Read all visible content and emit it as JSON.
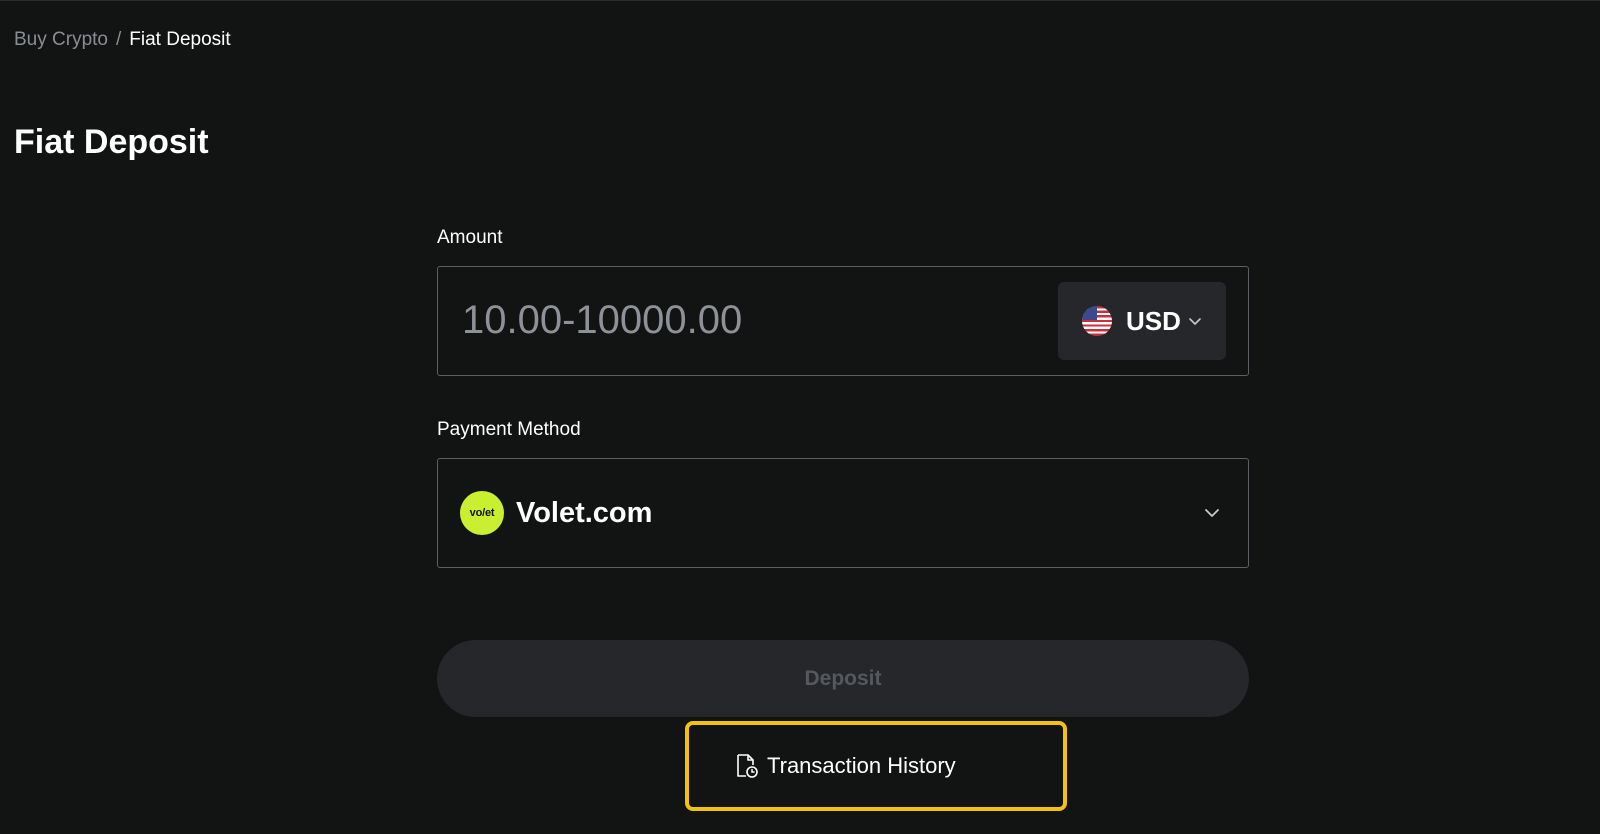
{
  "breadcrumb": {
    "parent": "Buy Crypto",
    "separator": "/",
    "current": "Fiat Deposit"
  },
  "page_title": "Fiat Deposit",
  "amount": {
    "label": "Amount",
    "placeholder": "10.00-10000.00",
    "value": "",
    "currency": {
      "code": "USD",
      "flag_icon": "us-flag-icon",
      "chevron_icon": "chevron-down-icon"
    }
  },
  "payment_method": {
    "label": "Payment Method",
    "selected": "Volet.com",
    "logo_text": "vo/et",
    "logo_color": "#c8f031",
    "chevron_icon": "chevron-down-icon"
  },
  "deposit_button": {
    "label": "Deposit",
    "enabled": false
  },
  "transaction_history": {
    "label": "Transaction History",
    "icon": "document-clock-icon",
    "highlight_color": "#f4c20d"
  },
  "colors": {
    "background": "#121313",
    "field_border": "#5b5e63",
    "button_bg": "#26272a",
    "muted_text": "#8a8d93"
  }
}
